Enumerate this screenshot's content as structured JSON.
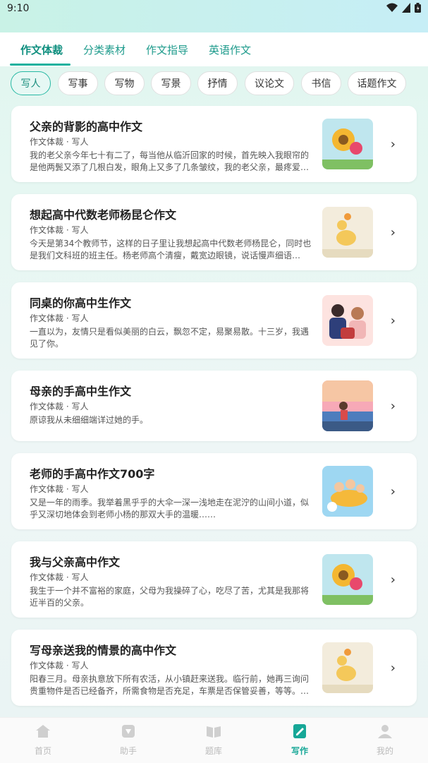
{
  "status": {
    "time": "9:10"
  },
  "tabs": [
    {
      "label": "作文体裁"
    },
    {
      "label": "分类素材"
    },
    {
      "label": "作文指导"
    },
    {
      "label": "英语作文"
    }
  ],
  "chips": [
    {
      "label": "写人"
    },
    {
      "label": "写事"
    },
    {
      "label": "写物"
    },
    {
      "label": "写景"
    },
    {
      "label": "抒情"
    },
    {
      "label": "议论文"
    },
    {
      "label": "书信"
    },
    {
      "label": "话题作文"
    }
  ],
  "articles": [
    {
      "title": "父亲的背影的高中作文",
      "meta": "作文体裁 · 写人",
      "excerpt": "我的老父亲今年七十有二了，每当他从临沂回家的时候，首先映入我眼帘的是他两鬓又添了几根白发，眼角上又多了几条皱纹，我的老父亲，最疼爱…",
      "thumb": "sunflower-girl-image"
    },
    {
      "title": "想起高中代数老师杨昆仑作文",
      "meta": "作文体裁 · 写人",
      "excerpt": "今天是第34个教师节，这样的日子里让我想起高中代数老师杨昆仑，同时也是我们文科班的班主任。杨老师高个清瘦，戴宽边眼镜，说话慢声细语…",
      "thumb": "duck-flower-image"
    },
    {
      "title": "同桌的你高中生作文",
      "meta": "作文体裁 · 写人",
      "excerpt": "一直以为，友情只是看似美丽的白云，飘忽不定，易聚易散。十三岁，我遇见了你。",
      "thumb": "family-illustration-image"
    },
    {
      "title": "母亲的手高中生作文",
      "meta": "作文体裁 · 写人",
      "excerpt": "原谅我从未细细端详过她的手。",
      "thumb": "sunset-girl-image"
    },
    {
      "title": "老师的手高中作文700字",
      "meta": "作文体裁 · 写人",
      "excerpt": "又是一年的雨季。我举着黑乎乎的大伞一深一浅地走在泥泞的山间小道，似乎又深切地体会到老师小杨的那双大手的温暖……",
      "thumb": "kids-airplane-image"
    },
    {
      "title": "我与父亲高中作文",
      "meta": "作文体裁 · 写人",
      "excerpt": "我生于一个并不富裕的家庭，父母为我操碎了心，吃尽了苦，尤其是我那将近半百的父亲。",
      "thumb": "sunflower-girl-image"
    },
    {
      "title": "写母亲送我的情景的高中作文",
      "meta": "作文体裁 · 写人",
      "excerpt": "阳春三月。母亲执意放下所有农活，从小镇赶来送我。临行前，她再三询问贵重物件是否已经备齐，所需食物是否充足，车票是否保管妥善，等等。…",
      "thumb": "duck-flower-image"
    }
  ],
  "nav": [
    {
      "label": "首页",
      "icon": "home-icon"
    },
    {
      "label": "助手",
      "icon": "assistant-icon"
    },
    {
      "label": "题库",
      "icon": "book-icon"
    },
    {
      "label": "写作",
      "icon": "write-icon"
    },
    {
      "label": "我的",
      "icon": "user-icon"
    }
  ],
  "colors": {
    "accent": "#19b19e",
    "chipActiveBg": "#e6f8f4"
  }
}
